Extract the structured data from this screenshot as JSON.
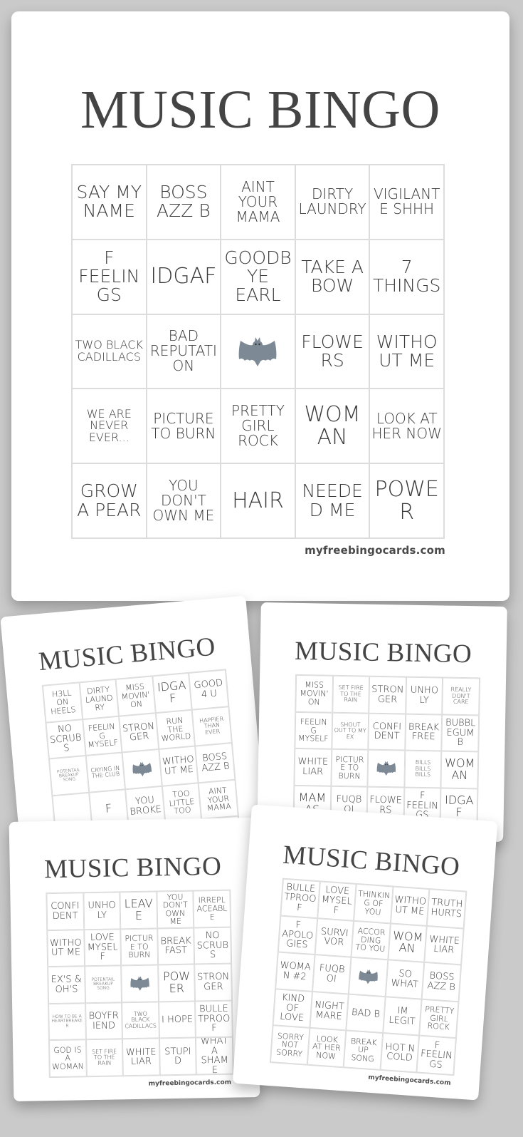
{
  "title": "MUSIC BINGO",
  "brand": "myfreebingocards.com",
  "free_space_icon": "bat-icon",
  "colors": {
    "background": "#cacaca",
    "card": "#ffffff",
    "title_text": "#444444",
    "cell_text": "#3a3a3a",
    "grid_line": "#dcdcdc",
    "bat": "#7d8a96"
  },
  "cards": [
    {
      "id": "main",
      "cells": [
        [
          "SAY MY NAME",
          "BOSS AZZ B",
          "AINT YOUR MAMA",
          "DIRTY LAUNDRY",
          "VIGILANTE SHHH"
        ],
        [
          "F FEELINGS",
          "IDGAF",
          "GOODBYE EARL",
          "TAKE A BOW",
          "7 THINGS"
        ],
        [
          "TWO BLACK CADILLACS",
          "BAD REPUTATION",
          "FREE",
          "FLOWERS",
          "WITHOUT ME"
        ],
        [
          "WE ARE NEVER EVER...",
          "PICTURE TO BURN",
          "PRETTY GIRL ROCK",
          "WOMAN",
          "LOOK AT HER NOW"
        ],
        [
          "GROW A PEAR",
          "YOU DON'T OWN ME",
          "HAIR",
          "NEEDED ME",
          "POWER"
        ]
      ]
    },
    {
      "id": "card-a",
      "cells": [
        [
          "H3LL ON HEELS",
          "DIRTY LAUNDRY",
          "MISS MOVIN' ON",
          "IDGAF",
          "GOOD 4 U"
        ],
        [
          "NO SCRUBS",
          "FEELING MYSELF",
          "STRONGER",
          "RUN THE WORLD",
          "HAPPIER THAN EVER"
        ],
        [
          "POTENTAIL BREAKUP SONG",
          "CRYING IN THE CLUB",
          "FREE",
          "WITHOUT ME",
          "BOSS AZZ B"
        ],
        [
          "",
          "F",
          "YOU BROKE",
          "TOO LITTLE TOO",
          "AINT YOUR MAMA"
        ],
        [
          "",
          "",
          "",
          "",
          ""
        ]
      ]
    },
    {
      "id": "card-b",
      "cells": [
        [
          "MISS MOVIN' ON",
          "SET FIRE TO THE RAIN",
          "STRONGER",
          "UNHOLY",
          "REALLY DON'T CARE"
        ],
        [
          "FEELING MYSELF",
          "SHOUT OUT TO MY EX",
          "CONFIDENT",
          "BREAK FREE",
          "BUBBLEGUM B"
        ],
        [
          "WHITE LIAR",
          "PICTURE TO BURN",
          "FREE",
          "BILLS BILLS BILLS",
          "WOMAN"
        ],
        [
          "MAMAS",
          "FUQBOI",
          "FLOWERS",
          "F FEELINGS",
          "IDGAF"
        ],
        [
          "",
          "",
          "",
          "",
          ""
        ]
      ]
    },
    {
      "id": "card-c",
      "cells": [
        [
          "CONFIDENT",
          "UNHOLY",
          "LEAVE",
          "YOU DON'T OWN ME",
          "IRREPLACEABLE"
        ],
        [
          "WITHOUT ME",
          "LOVE MYSELF",
          "PICTURE TO BURN",
          "BREAKFAST",
          "NO SCRUBS"
        ],
        [
          "EX'S & OH'S",
          "POTENTAIL BREAKUP SONG",
          "FREE",
          "POWER",
          "STRONGER"
        ],
        [
          "HOW TO BE A HEARTBREAKER",
          "BOYFRIEND",
          "TWO BLACK CADILLACS",
          "I HOPE",
          "BULLETPROOF"
        ],
        [
          "GOD IS A WOMAN",
          "SET FIRE TO THE RAIN",
          "WHITE LIAR",
          "STUPID",
          "WHAT A SHAME"
        ]
      ]
    },
    {
      "id": "card-d",
      "cells": [
        [
          "BULLETPROOF",
          "LOVE MYSELF",
          "THINKING OF YOU",
          "WITHOUT ME",
          "TRUTH HURTS"
        ],
        [
          "F APOLOGIES",
          "SURVIVOR",
          "ACCORDING TO YOU",
          "WOMAN",
          "WHITE LIAR"
        ],
        [
          "WOMAN #2",
          "FUQBOI",
          "FREE",
          "SO WHAT",
          "BOSS AZZ B"
        ],
        [
          "KIND OF LOVE",
          "NIGHTMARE",
          "BAD B",
          "IM LEGIT",
          "PRETTY GIRL ROCK"
        ],
        [
          "SORRY NOT SORRY",
          "LOOK AT HER NOW",
          "BREAK UP SONG",
          "HOT N COLD",
          "F FEELINGS"
        ]
      ]
    }
  ]
}
